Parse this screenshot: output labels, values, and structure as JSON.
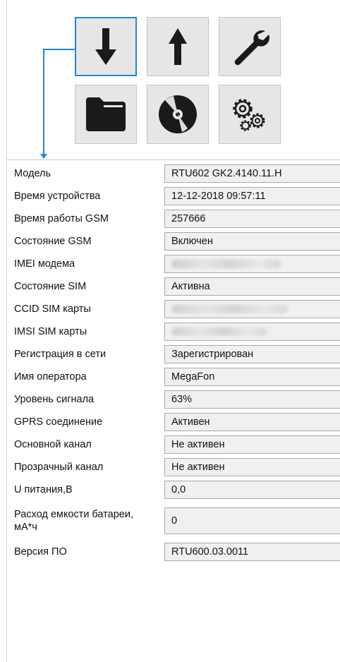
{
  "toolbar": {
    "buttons": [
      {
        "name": "download-icon"
      },
      {
        "name": "upload-icon"
      },
      {
        "name": "wrench-icon"
      },
      {
        "name": "folder-icon"
      },
      {
        "name": "disc-icon"
      },
      {
        "name": "gears-icon"
      }
    ],
    "selected": "download-icon",
    "accent_color": "#1e88d8"
  },
  "rows": [
    {
      "label": "Модель",
      "value": "RTU602 GK2.4140.11.H"
    },
    {
      "label": "Время устройства",
      "value": "12-12-2018 09:57:11"
    },
    {
      "label": "Время работы GSM",
      "value": "257666"
    },
    {
      "label": "Состояние GSM",
      "value": "Включен"
    },
    {
      "label": "IMEI модема",
      "value": ""
    },
    {
      "label": "Состояние SIM",
      "value": "Активна"
    },
    {
      "label": "CCID SIM карты",
      "value": ""
    },
    {
      "label": "IMSI SIM карты",
      "value": ""
    },
    {
      "label": "Регистрация в сети",
      "value": "Зарегистрирован"
    },
    {
      "label": "Имя оператора",
      "value": "MegaFon"
    },
    {
      "label": "Уровень сигнала",
      "value": "63%"
    },
    {
      "label": "GPRS соединение",
      "value": "Активен"
    },
    {
      "label": "Основной канал",
      "value": "Не активен"
    },
    {
      "label": "Прозрачный канал",
      "value": "Не активен"
    },
    {
      "label": "U питания,В",
      "value": "0,0"
    },
    {
      "label": "Расход емкости батареи, мА*ч",
      "value": "0"
    },
    {
      "label": "Версия ПО",
      "value": "RTU600.03.0011"
    }
  ]
}
